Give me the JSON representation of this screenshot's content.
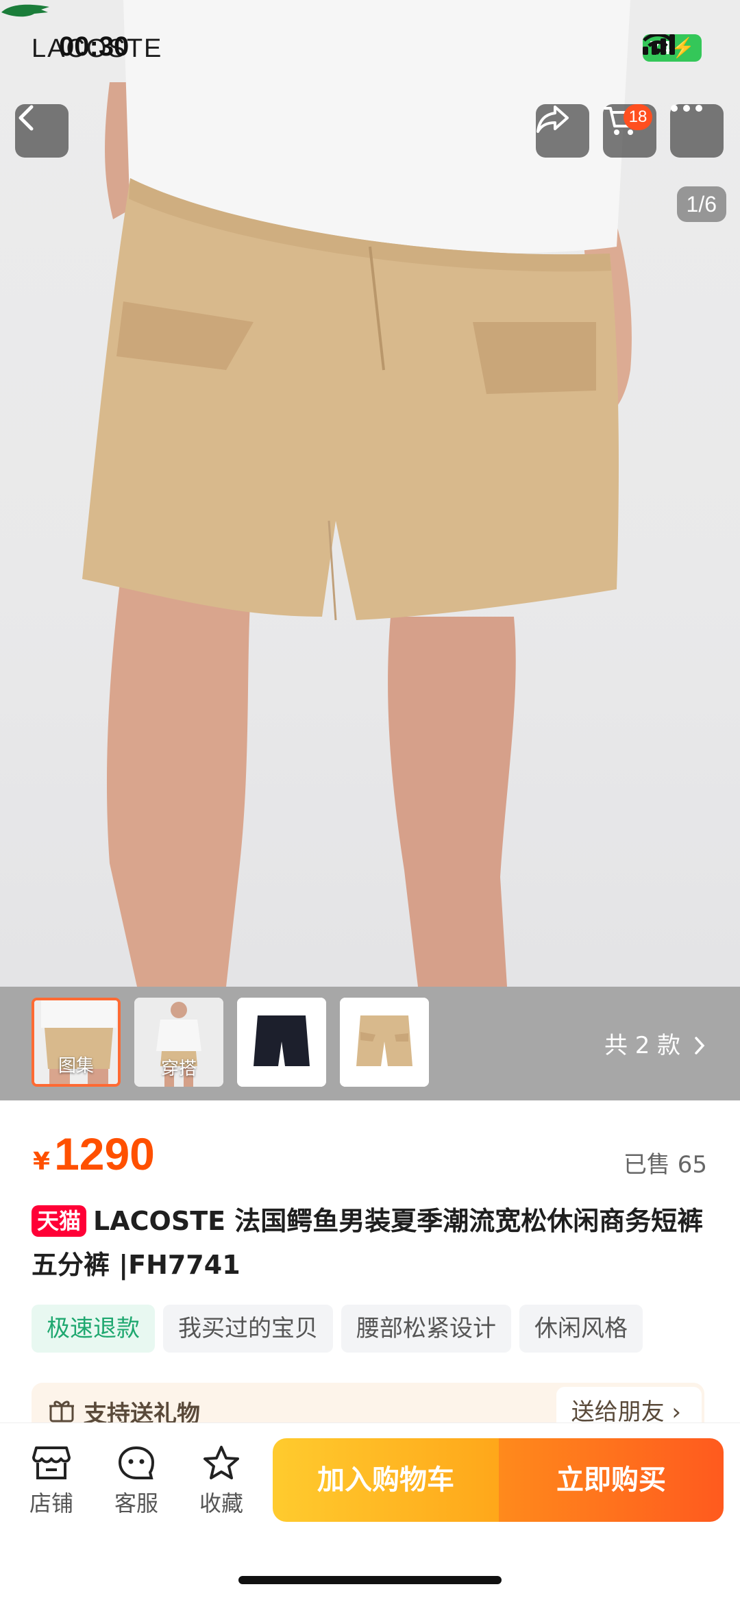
{
  "status_bar": {
    "time": "00:30",
    "battery": "74"
  },
  "hero": {
    "brand_text": "LACOSTE",
    "counter": "1/6",
    "cart_badge": "18"
  },
  "thumbnails": [
    {
      "label": "图集",
      "active": true
    },
    {
      "label": "穿搭",
      "active": false
    },
    {
      "label": "",
      "active": false
    },
    {
      "label": "",
      "active": false
    }
  ],
  "variants_link": "共 2 款",
  "product": {
    "price_symbol": "¥",
    "price": "1290",
    "sold": "已售 65",
    "store_tag": "天猫",
    "title": "LACOSTE 法国鳄鱼男装夏季潮流宽松休闲商务短裤五分裤 |FH7741",
    "tags": [
      "极速退款",
      "我买过的宝贝",
      "腰部松紧设计",
      "休闲风格"
    ]
  },
  "gift": {
    "text": "支持送礼物",
    "button": "送给朋友"
  },
  "bottom_bar": {
    "store": "店铺",
    "service": "客服",
    "favorite": "收藏",
    "add_to_cart": "加入购物车",
    "buy_now": "立即购买"
  },
  "colors": {
    "accent": "#ff5000",
    "tmall": "#ff0036",
    "khaki": "#d8b98c"
  }
}
